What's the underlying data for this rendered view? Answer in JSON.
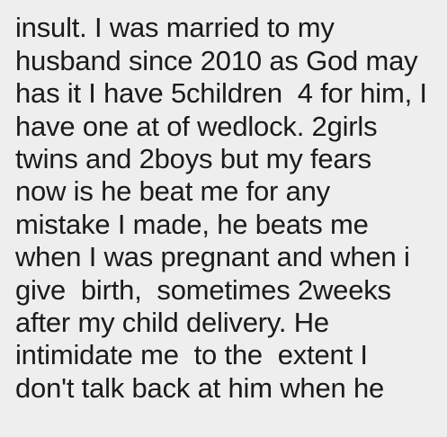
{
  "message": {
    "lines": [
      "",
      "insult. I was married to my",
      "husband since 2010 as God may",
      "has it I have 5children  4 for him, I",
      "have one at of wedlock. 2girls",
      "twins and 2boys but my fears",
      "now is he beat me for any",
      "mistake I made, he beats me",
      "when I was pregnant and when i",
      "give  birth,  sometimes 2weeks",
      "after my child delivery. He",
      "intimidate me  to the  extent I",
      "don't talk back at him when he",
      ""
    ]
  },
  "colors": {
    "background": "#eeeeee",
    "text": "#1b1b1b"
  }
}
